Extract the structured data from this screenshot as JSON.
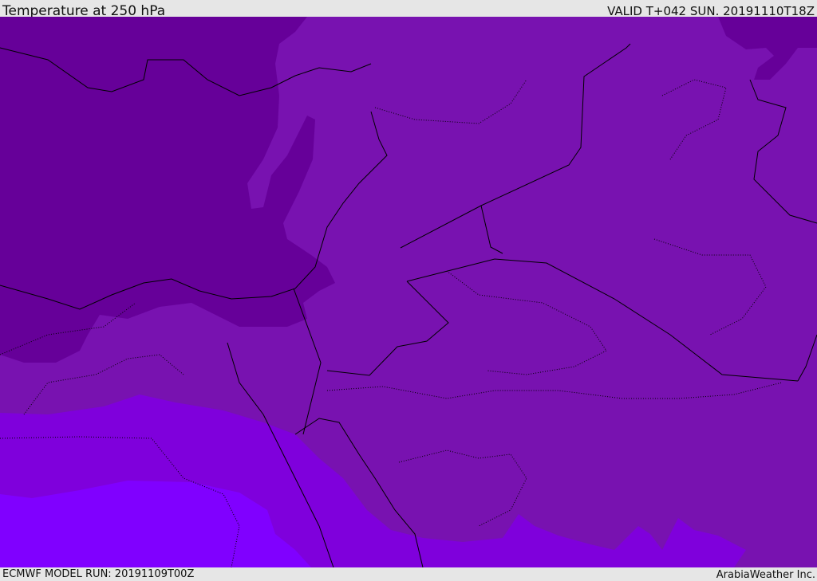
{
  "header": {
    "title": "Temperature at 250 hPa",
    "valid": "VALID T+042 SUN. 20191110T18Z"
  },
  "footer": {
    "model_run": "ECMWF MODEL RUN: 20191109T00Z",
    "brand": "ArabiaWeather Inc."
  },
  "colors": {
    "coldest": "#660099",
    "cold": "#7812b0",
    "mild": "#7f00dc",
    "warm": "#8000ff",
    "border": "#000000"
  }
}
